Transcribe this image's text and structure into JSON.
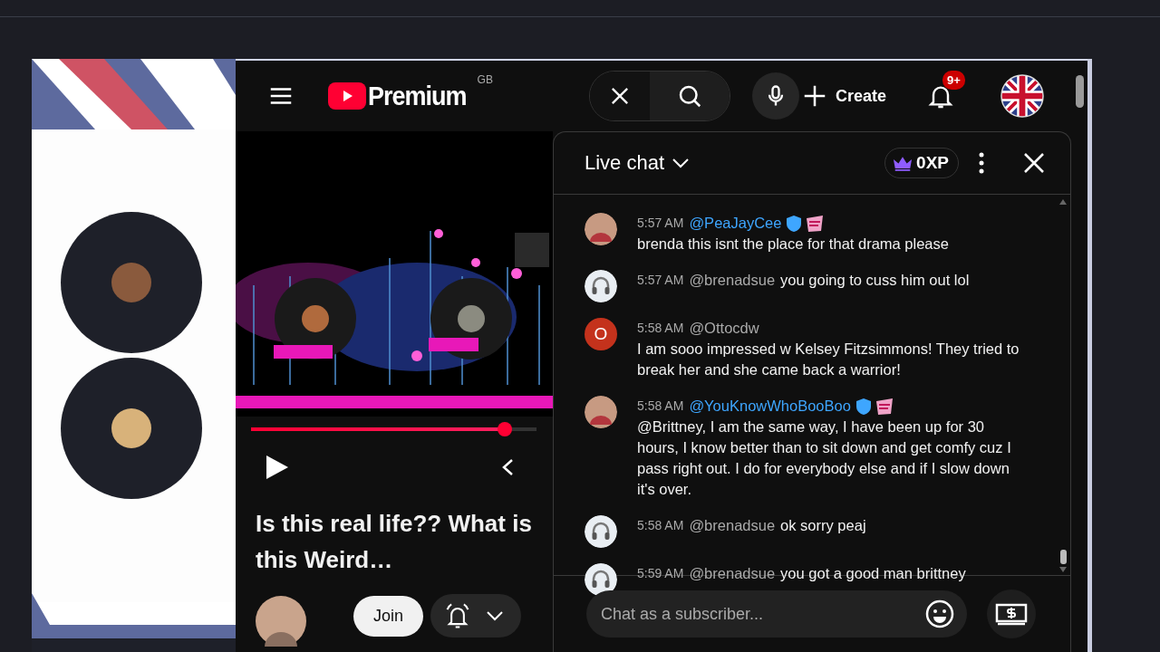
{
  "topbar": {
    "logo": "Premium",
    "region": "GB",
    "create": "Create",
    "notifications": "9+"
  },
  "player": {
    "kind": "picture",
    "progress": {
      "level": 0.89
    }
  },
  "video_title": "Is this real life?? What is this Weird…",
  "join": "Join",
  "chat": {
    "title": "Live chat",
    "xp": "0XP",
    "messages": [
      {
        "time": "5:57 AM",
        "author": "@PeaJayCee",
        "member": true,
        "sticker": true,
        "text": "brenda this isnt the place for that drama please"
      },
      {
        "time": "5:57 AM",
        "author": "@brenadsue",
        "member": false,
        "sticker": false,
        "avatar": {
          "kind": "headphones"
        },
        "text": "you going to cuss him out lol"
      },
      {
        "time": "5:58 AM",
        "author": "@Ottocdw",
        "member": false,
        "sticker": false,
        "avatar": {
          "kind": "letter",
          "letter": "O",
          "color": "#c4321c"
        },
        "text": "I am sooo impressed w Kelsey Fitzsimmons! They tried to break her and she came back a warrior!"
      },
      {
        "time": "5:58 AM",
        "author": "@YouKnowWhoBooBoo",
        "member": true,
        "sticker": true,
        "text": "@Brittney, I am the same way, I have been up for 30 hours, I know better than to sit down and get comfy cuz I pass right out. I do for everybody else and if I slow down it's over."
      },
      {
        "time": "5:58 AM",
        "author": "@brenadsue",
        "member": false,
        "sticker": false,
        "avatar": {
          "kind": "headphones"
        },
        "text": "ok sorry peaj"
      },
      {
        "time": "5:59 AM",
        "author": "@brenadsue",
        "member": false,
        "sticker": false,
        "avatar": {
          "kind": "headphones"
        },
        "text": "you got a good man brittney"
      }
    ],
    "placeholder": "Chat as a subscriber..."
  }
}
